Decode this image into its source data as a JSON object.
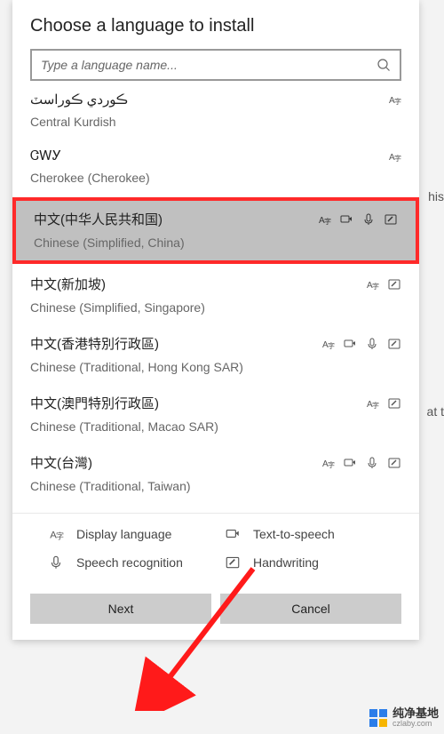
{
  "title": "Choose a language to install",
  "search": {
    "placeholder": "Type a language name..."
  },
  "languages": [
    {
      "native": "ڪوردي ڪوراسٽ",
      "english": "Central Kurdish",
      "features": [
        "display"
      ]
    },
    {
      "native": "ᏣᎳᎩ",
      "english": "Cherokee (Cherokee)",
      "features": [
        "display"
      ]
    },
    {
      "native": "中文(中华人民共和国)",
      "english": "Chinese (Simplified, China)",
      "features": [
        "display",
        "tts",
        "speech",
        "handwriting"
      ]
    },
    {
      "native": "中文(新加坡)",
      "english": "Chinese (Simplified, Singapore)",
      "features": [
        "display",
        "handwriting"
      ]
    },
    {
      "native": "中文(香港特別行政區)",
      "english": "Chinese (Traditional, Hong Kong SAR)",
      "features": [
        "display",
        "tts",
        "speech",
        "handwriting"
      ]
    },
    {
      "native": "中文(澳門特別行政區)",
      "english": "Chinese (Traditional, Macao SAR)",
      "features": [
        "display",
        "handwriting"
      ]
    },
    {
      "native": "中文(台灣)",
      "english": "Chinese (Traditional, Taiwan)",
      "features": [
        "display",
        "tts",
        "speech",
        "handwriting"
      ]
    }
  ],
  "legend": {
    "display": "Display language",
    "tts": "Text-to-speech",
    "speech": "Speech recognition",
    "handwriting": "Handwriting"
  },
  "buttons": {
    "next": "Next",
    "cancel": "Cancel"
  },
  "bg_hints": {
    "his": "his",
    "at_t": "at t"
  },
  "watermark": {
    "cn": "纯净基地",
    "url": "czlaby.com"
  }
}
